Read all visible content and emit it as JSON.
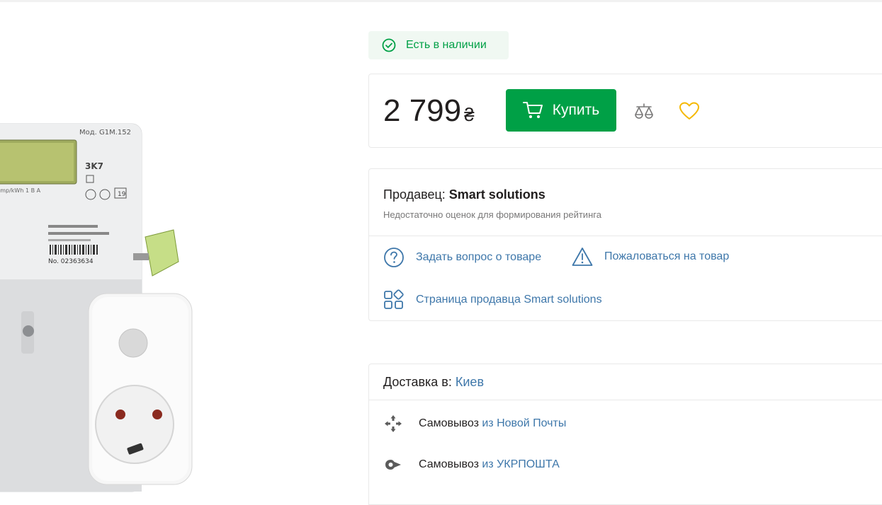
{
  "product": {
    "image_alt_model": "Мод. G1M.152",
    "meter_code": "3K7",
    "meter_serial": "No. 02363634"
  },
  "availability": {
    "label": "Есть в наличии",
    "icon": "check-circle-icon",
    "color": "#00a046"
  },
  "price": {
    "amount": "2 799",
    "currency": "₴"
  },
  "buttons": {
    "buy_label": "Купить",
    "buy_color": "#00a046",
    "compare_icon": "scales-icon",
    "wishlist_icon": "heart-icon",
    "wishlist_color": "#f5b800"
  },
  "seller": {
    "prefix": "Продавец:",
    "name": "Smart solutions",
    "rating_note": "Недостаточно оценок для формирования рейтинга",
    "ask_question": "Задать вопрос о товаре",
    "complain": "Пожаловаться на товар",
    "seller_page": "Страница продавца Smart solutions",
    "link_color": "#3e77aa"
  },
  "delivery": {
    "prefix": "Доставка в:",
    "city": "Киев",
    "options": [
      {
        "method": "Самовывоз",
        "provider": "из Новой Почты",
        "icon": "nova-poshta-icon"
      },
      {
        "method": "Самовывоз",
        "provider": "из УКРПОШТА",
        "icon": "ukrposhta-icon"
      }
    ]
  }
}
